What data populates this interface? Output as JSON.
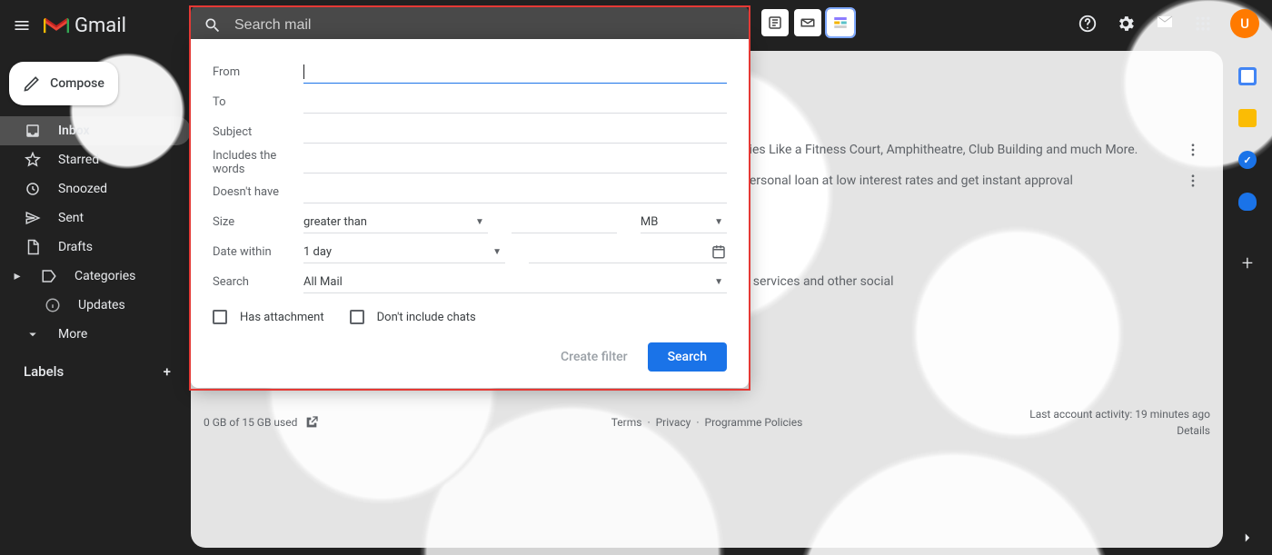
{
  "app_name": "Gmail",
  "search_placeholder": "Search mail",
  "compose_label": "Compose",
  "nav": {
    "inbox": "Inbox",
    "starred": "Starred",
    "snoozed": "Snoozed",
    "sent": "Sent",
    "drafts": "Drafts",
    "categories": "Categories",
    "updates": "Updates",
    "more": "More"
  },
  "labels_header": "Labels",
  "filter_form": {
    "from": "From",
    "to": "To",
    "subject": "Subject",
    "includes": "Includes the words",
    "doesnt": "Doesn't have",
    "size": "Size",
    "size_op": "greater than",
    "size_unit": "MB",
    "date_within": "Date within",
    "date_range": "1 day",
    "search_in": "Search",
    "search_scope": "All Mail",
    "has_attachment": "Has attachment",
    "no_chats": "Don't include chats",
    "create_filter": "Create filter",
    "search_btn": "Search"
  },
  "mail_snippets": {
    "row1": "Amenities Like a Fitness Court, Amphitheatre, Club Building and much More.",
    "row2": "quick personal loan at low interest rates and get instant approval",
    "extra": ", dating services and other social"
  },
  "footer": {
    "storage": "0 GB of 15 GB used",
    "terms": "Terms",
    "privacy": "Privacy",
    "policies": "Programme Policies",
    "activity": "Last account activity: 19 minutes ago",
    "details": "Details"
  },
  "avatar_initial": "U"
}
